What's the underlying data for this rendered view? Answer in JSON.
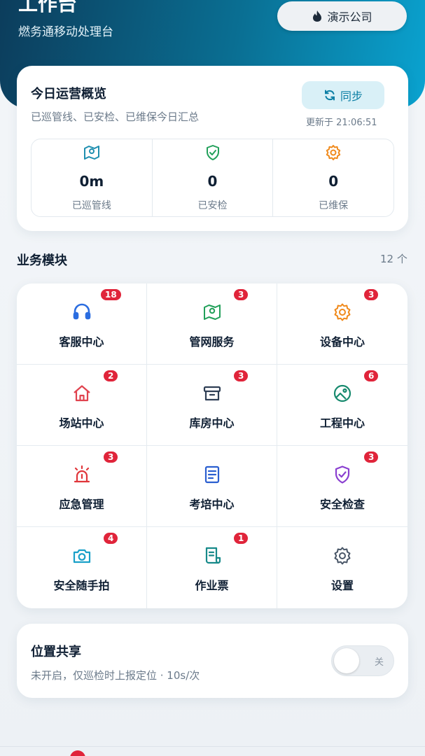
{
  "header": {
    "title": "工作台",
    "subtitle": "燃务通移动处理台",
    "company_label": "演示公司",
    "company_icon": "flame-icon"
  },
  "overview": {
    "title": "今日运营概览",
    "subtitle": "已巡管线、已安检、已维保今日汇总",
    "sync_label": "同步",
    "updated": "更新于 21:06:51",
    "stats": [
      {
        "value": "0m",
        "label": "已巡管线",
        "icon": "map-pin-icon",
        "color": "#1f8fb0"
      },
      {
        "value": "0",
        "label": "已安检",
        "icon": "shield-check-icon",
        "color": "#22a05a"
      },
      {
        "value": "0",
        "label": "已维保",
        "icon": "gear-icon",
        "color": "#f08a1c"
      }
    ]
  },
  "modules": {
    "title": "业务模块",
    "count": "12 个",
    "items": [
      {
        "label": "客服中心",
        "badge": "18",
        "icon": "headset-icon",
        "color": "#2b6de0"
      },
      {
        "label": "管网服务",
        "badge": "3",
        "icon": "map-pin-icon",
        "color": "#22a05a"
      },
      {
        "label": "设备中心",
        "badge": "3",
        "icon": "gear-icon",
        "color": "#f08a1c"
      },
      {
        "label": "场站中心",
        "badge": "2",
        "icon": "home-icon",
        "color": "#e0434f"
      },
      {
        "label": "库房中心",
        "badge": "3",
        "icon": "archive-box-icon",
        "color": "#2f3f55"
      },
      {
        "label": "工程中心",
        "badge": "6",
        "icon": "image-icon",
        "color": "#178a6e"
      },
      {
        "label": "应急管理",
        "badge": "3",
        "icon": "alarm-siren-icon",
        "color": "#e0363b"
      },
      {
        "label": "考培中心",
        "badge": "",
        "icon": "document-list-icon",
        "color": "#2b5fd0"
      },
      {
        "label": "安全检查",
        "badge": "3",
        "icon": "shield-check-icon",
        "color": "#8a3fd0"
      },
      {
        "label": "安全随手拍",
        "badge": "4",
        "icon": "camera-icon",
        "color": "#1aa0c8"
      },
      {
        "label": "作业票",
        "badge": "1",
        "icon": "receipt-icon",
        "color": "#178a8a"
      },
      {
        "label": "设置",
        "badge": "",
        "icon": "gear-icon",
        "color": "#4a5768"
      }
    ]
  },
  "location": {
    "title": "位置共享",
    "subtitle": "未开启，仅巡检时上报定位 · 10s/次",
    "toggle_label": "关"
  }
}
